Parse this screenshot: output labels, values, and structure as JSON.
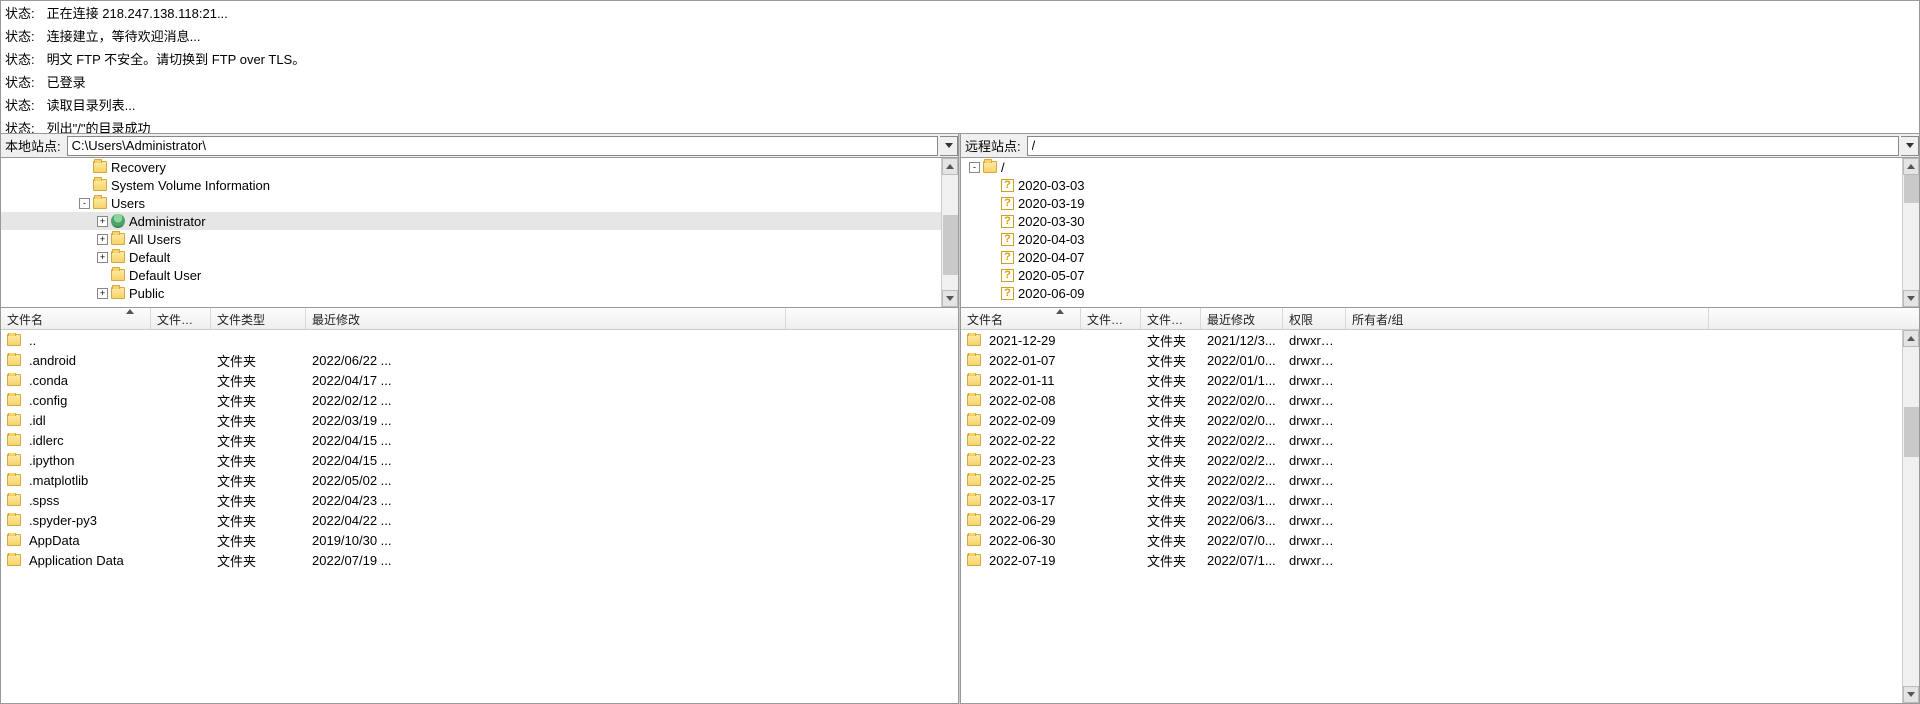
{
  "log": {
    "label": "状态:",
    "lines": [
      "正在连接 218.247.138.118:21...",
      "连接建立，等待欢迎消息...",
      "明文 FTP 不安全。请切换到 FTP over TLS。",
      "已登录",
      "读取目录列表...",
      "列出\"/\"的目录成功"
    ]
  },
  "local": {
    "label": "本地站点:",
    "path": "C:\\Users\\Administrator\\",
    "tree": [
      {
        "depth": 3,
        "expand": "",
        "icon": "folder",
        "label": "Recovery"
      },
      {
        "depth": 3,
        "expand": "",
        "icon": "folder",
        "label": "System Volume Information"
      },
      {
        "depth": 3,
        "expand": "-",
        "icon": "folder",
        "label": "Users"
      },
      {
        "depth": 4,
        "expand": "+",
        "icon": "user",
        "label": "Administrator",
        "selected": true
      },
      {
        "depth": 4,
        "expand": "+",
        "icon": "folder",
        "label": "All Users"
      },
      {
        "depth": 4,
        "expand": "+",
        "icon": "folder",
        "label": "Default"
      },
      {
        "depth": 4,
        "expand": "",
        "icon": "folder",
        "label": "Default User"
      },
      {
        "depth": 4,
        "expand": "+",
        "icon": "folder",
        "label": "Public"
      }
    ],
    "columns": {
      "name": "文件名",
      "size": "文件大小",
      "type": "文件类型",
      "modified": "最近修改"
    },
    "files": [
      {
        "name": "..",
        "size": "",
        "type": "",
        "modified": ""
      },
      {
        "name": ".android",
        "size": "",
        "type": "文件夹",
        "modified": "2022/06/22 ..."
      },
      {
        "name": ".conda",
        "size": "",
        "type": "文件夹",
        "modified": "2022/04/17 ..."
      },
      {
        "name": ".config",
        "size": "",
        "type": "文件夹",
        "modified": "2022/02/12 ..."
      },
      {
        "name": ".idl",
        "size": "",
        "type": "文件夹",
        "modified": "2022/03/19 ..."
      },
      {
        "name": ".idlerc",
        "size": "",
        "type": "文件夹",
        "modified": "2022/04/15 ..."
      },
      {
        "name": ".ipython",
        "size": "",
        "type": "文件夹",
        "modified": "2022/04/15 ..."
      },
      {
        "name": ".matplotlib",
        "size": "",
        "type": "文件夹",
        "modified": "2022/05/02 ..."
      },
      {
        "name": ".spss",
        "size": "",
        "type": "文件夹",
        "modified": "2022/04/23 ..."
      },
      {
        "name": ".spyder-py3",
        "size": "",
        "type": "文件夹",
        "modified": "2022/04/22 ..."
      },
      {
        "name": "AppData",
        "size": "",
        "type": "文件夹",
        "modified": "2019/10/30 ..."
      },
      {
        "name": "Application Data",
        "size": "",
        "type": "文件夹",
        "modified": "2022/07/19 ..."
      }
    ]
  },
  "remote": {
    "label": "远程站点:",
    "path": "/",
    "tree": [
      {
        "depth": 0,
        "expand": "-",
        "icon": "folder",
        "label": "/"
      },
      {
        "depth": 1,
        "expand": "",
        "icon": "q",
        "label": "2020-03-03"
      },
      {
        "depth": 1,
        "expand": "",
        "icon": "q",
        "label": "2020-03-19"
      },
      {
        "depth": 1,
        "expand": "",
        "icon": "q",
        "label": "2020-03-30"
      },
      {
        "depth": 1,
        "expand": "",
        "icon": "q",
        "label": "2020-04-03"
      },
      {
        "depth": 1,
        "expand": "",
        "icon": "q",
        "label": "2020-04-07"
      },
      {
        "depth": 1,
        "expand": "",
        "icon": "q",
        "label": "2020-05-07"
      },
      {
        "depth": 1,
        "expand": "",
        "icon": "q",
        "label": "2020-06-09"
      }
    ],
    "columns": {
      "name": "文件名",
      "size": "文件大小",
      "type": "文件类型",
      "modified": "最近修改",
      "perm": "权限",
      "owner": "所有者/组"
    },
    "files": [
      {
        "name": "2021-12-29",
        "size": "",
        "type": "文件夹",
        "modified": "2021/12/3...",
        "perm": "drwxrw...",
        "owner": ""
      },
      {
        "name": "2022-01-07",
        "size": "",
        "type": "文件夹",
        "modified": "2022/01/0...",
        "perm": "drwxrw...",
        "owner": ""
      },
      {
        "name": "2022-01-11",
        "size": "",
        "type": "文件夹",
        "modified": "2022/01/1...",
        "perm": "drwxrw...",
        "owner": ""
      },
      {
        "name": "2022-02-08",
        "size": "",
        "type": "文件夹",
        "modified": "2022/02/0...",
        "perm": "drwxrw...",
        "owner": ""
      },
      {
        "name": "2022-02-09",
        "size": "",
        "type": "文件夹",
        "modified": "2022/02/0...",
        "perm": "drwxrw...",
        "owner": ""
      },
      {
        "name": "2022-02-22",
        "size": "",
        "type": "文件夹",
        "modified": "2022/02/2...",
        "perm": "drwxrw...",
        "owner": ""
      },
      {
        "name": "2022-02-23",
        "size": "",
        "type": "文件夹",
        "modified": "2022/02/2...",
        "perm": "drwxrw...",
        "owner": ""
      },
      {
        "name": "2022-02-25",
        "size": "",
        "type": "文件夹",
        "modified": "2022/02/2...",
        "perm": "drwxrw...",
        "owner": ""
      },
      {
        "name": "2022-03-17",
        "size": "",
        "type": "文件夹",
        "modified": "2022/03/1...",
        "perm": "drwxrw...",
        "owner": ""
      },
      {
        "name": "2022-06-29",
        "size": "",
        "type": "文件夹",
        "modified": "2022/06/3...",
        "perm": "drwxrw...",
        "owner": ""
      },
      {
        "name": "2022-06-30",
        "size": "",
        "type": "文件夹",
        "modified": "2022/07/0...",
        "perm": "drwxrw...",
        "owner": ""
      },
      {
        "name": "2022-07-19",
        "size": "",
        "type": "文件夹",
        "modified": "2022/07/1...",
        "perm": "drwxrw...",
        "owner": ""
      }
    ]
  }
}
